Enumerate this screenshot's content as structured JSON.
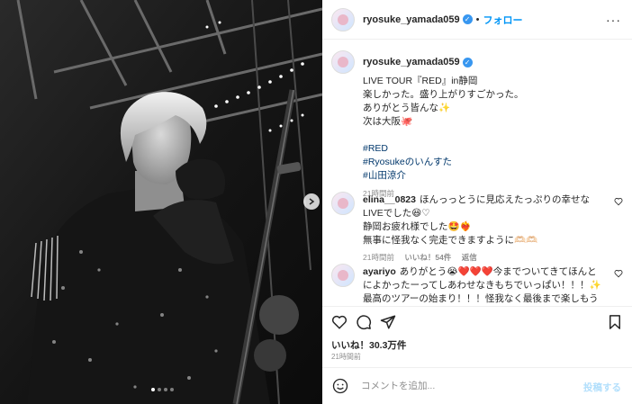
{
  "author": {
    "username": "ryosuke_yamada059",
    "follow_label": "フォロー",
    "separator": "•",
    "more": "···"
  },
  "caption": {
    "lines": [
      "LIVE TOUR『RED』in静岡",
      "楽しかった。盛り上がりすごかった。",
      "ありがとう皆んな✨",
      "次は大阪🐙"
    ],
    "tags": [
      "#RED",
      "#Ryosukeのいんすた",
      "#山田涼介"
    ],
    "time": "21時間前"
  },
  "comments": [
    {
      "username": "elina__0823",
      "lines": [
        "ほんっっとうに見応えたっぷりの幸せなLIVEでした😆♡",
        "静岡お疲れ様でした🤩❤️‍🔥",
        "無事に怪我なく完走できますように🫶🏻🫶🏻"
      ],
      "time": "21時間前",
      "likes": "いいね！54件",
      "reply": "返信"
    },
    {
      "username": "ayariyo",
      "lines": [
        "ありがとう😭❤️❤️❤️今までついてきてほんとによかったーってしあわせなきもちでいっぱい！！！✨最高のツアーの始まり！！！怪我なく最後まで楽しもうね✨"
      ]
    }
  ],
  "likes": "いいね！30.3万件",
  "post_time": "21時間前",
  "comment_box": {
    "placeholder": "コメントを追加...",
    "post_label": "投稿する"
  },
  "carousel": {
    "slide_count": 4,
    "active_index": 0
  }
}
